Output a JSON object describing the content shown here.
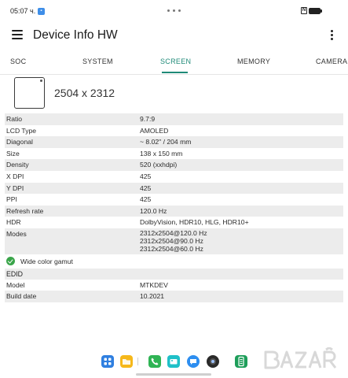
{
  "status_bar": {
    "time": "05:07 ч."
  },
  "app_bar": {
    "title": "Device Info HW"
  },
  "tabs": [
    {
      "label": "SOC"
    },
    {
      "label": "SYSTEM"
    },
    {
      "label": "SCREEN",
      "active": true
    },
    {
      "label": "MEMORY"
    },
    {
      "label": "CAMERA"
    }
  ],
  "screen": {
    "resolution": "2504 x 2312",
    "rows": [
      {
        "key": "Ratio",
        "value": "9.7:9"
      },
      {
        "key": "LCD Type",
        "value": "AMOLED"
      },
      {
        "key": "Diagonal",
        "value": "~ 8.02\" / 204 mm"
      },
      {
        "key": "Size",
        "value": "138 x 150 mm"
      },
      {
        "key": "Density",
        "value": "520 (xxhdpi)"
      },
      {
        "key": "X DPI",
        "value": "425"
      },
      {
        "key": "Y DPI",
        "value": "425"
      },
      {
        "key": "PPI",
        "value": "425"
      },
      {
        "key": "Refresh rate",
        "value": "120.0 Hz"
      },
      {
        "key": "HDR",
        "value": "DolbyVision, HDR10, HLG, HDR10+"
      }
    ],
    "modes": {
      "key": "Modes",
      "values": [
        "2312x2504@120.0 Hz",
        "2312x2504@90.0 Hz",
        "2312x2504@60.0 Hz"
      ]
    },
    "wide_color_gamut": "Wide color gamut",
    "edid": {
      "title": "EDID",
      "rows": [
        {
          "key": "Model",
          "value": "MTKDEV"
        },
        {
          "key": "Build date",
          "value": "10.2021"
        }
      ]
    }
  },
  "dock": {
    "icons": [
      "apps-icon",
      "files-icon",
      "phone-icon",
      "gallery-icon",
      "messages-icon",
      "camera-icon",
      "device-info-icon"
    ]
  },
  "colors": {
    "accent": "#1f8a78",
    "stripe": "#ececec",
    "check": "#3aa54a"
  }
}
